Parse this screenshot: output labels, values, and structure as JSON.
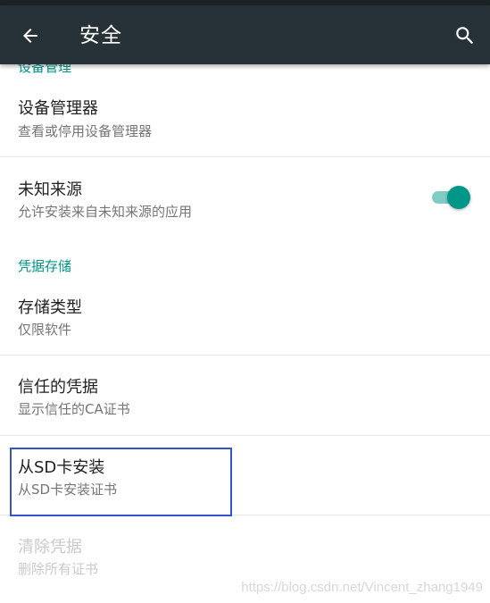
{
  "toolbar": {
    "title": "安全",
    "back_icon": "arrow-back-icon",
    "search_icon": "search-icon",
    "background": "#263238"
  },
  "sections": {
    "device_admin_header": "设备管理",
    "credential_storage_header": "凭据存储"
  },
  "items": {
    "device_admins": {
      "title": "设备管理器",
      "summary": "查看或停用设备管理器"
    },
    "unknown_sources": {
      "title": "未知来源",
      "summary": "允许安装来自未知来源的应用",
      "toggle_on": true
    },
    "storage_type": {
      "title": "存储类型",
      "summary": "仅限软件"
    },
    "trusted_credentials": {
      "title": "信任的凭据",
      "summary": "显示信任的CA证书"
    },
    "install_from_sd": {
      "title": "从SD卡安装",
      "summary": "从SD卡安装证书"
    },
    "clear_credentials": {
      "title": "清除凭据",
      "summary": "删除所有证书",
      "enabled": false
    }
  },
  "watermark": "https://blog.csdn.net/Vincent_zhang1949",
  "colors": {
    "accent": "#009688",
    "toggle_track": "#80cbc4",
    "highlight_box": "#3355c8"
  }
}
